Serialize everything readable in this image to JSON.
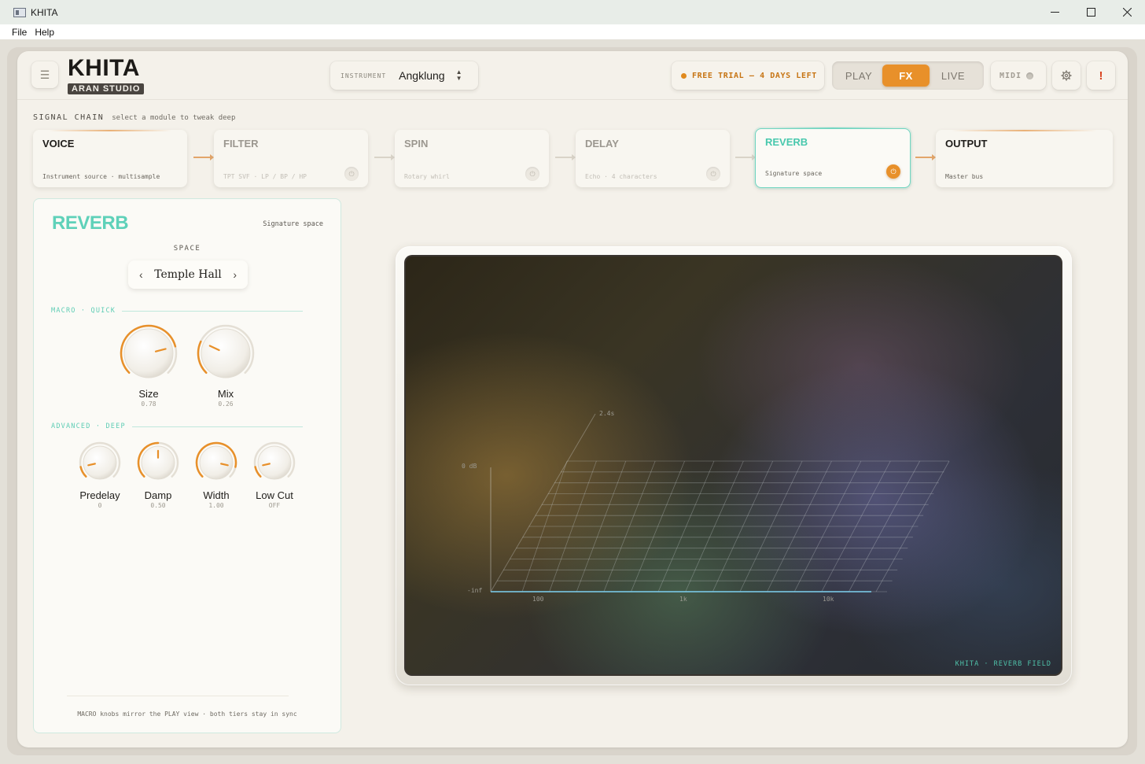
{
  "window": {
    "title": "KHITA",
    "minimize_icon": "minimize-icon",
    "maximize_icon": "maximize-icon",
    "close_icon": "close-icon"
  },
  "menubar": {
    "items": [
      "File",
      "Help"
    ]
  },
  "header": {
    "menu_icon": "hamburger-icon",
    "logo_title": "KHITA",
    "logo_badge": "ARAN STUDIO",
    "instrument": {
      "label": "INSTRUMENT",
      "value": "Angklung"
    },
    "trial": {
      "text": "FREE TRIAL — 4 DAYS LEFT",
      "dot_color": "#e08a1e"
    },
    "modes": [
      {
        "label": "PLAY",
        "active": false
      },
      {
        "label": "FX",
        "active": true
      },
      {
        "label": "LIVE",
        "active": false
      }
    ],
    "midi": {
      "label": "MIDI",
      "active": false
    },
    "settings_icon": "gear-icon",
    "alert_text": "!"
  },
  "signal_chain": {
    "label": "SIGNAL CHAIN",
    "hint": "select a module to tweak deep",
    "modules": [
      {
        "title": "VOICE",
        "subtitle": "Instrument source · multisample",
        "enabled": true,
        "has_power": false
      },
      {
        "title": "FILTER",
        "subtitle": "TPT SVF · LP / BP / HP",
        "enabled": false,
        "has_power": true
      },
      {
        "title": "SPIN",
        "subtitle": "Rotary whirl",
        "enabled": false,
        "has_power": true
      },
      {
        "title": "DELAY",
        "subtitle": "Echo · 4 characters",
        "enabled": false,
        "has_power": true
      },
      {
        "title": "REVERB",
        "subtitle": "Signature space",
        "enabled": true,
        "has_power": true,
        "selected": true
      },
      {
        "title": "OUTPUT",
        "subtitle": "Master bus",
        "enabled": true,
        "has_power": false
      }
    ]
  },
  "reverb_panel": {
    "title": "REVERB",
    "subtitle": "Signature space",
    "space": {
      "label": "SPACE",
      "value": "Temple Hall",
      "prev_icon": "chevron-left-icon",
      "next_icon": "chevron-right-icon"
    },
    "macro": {
      "label": "MACRO · QUICK",
      "knobs": [
        {
          "name": "Size",
          "value": "0.78",
          "level": 0.78
        },
        {
          "name": "Mix",
          "value": "0.26",
          "level": 0.26
        }
      ]
    },
    "advanced": {
      "label": "ADVANCED · DEEP",
      "knobs": [
        {
          "name": "Predelay",
          "value": "0",
          "level": 0.12
        },
        {
          "name": "Damp",
          "value": "0.50",
          "level": 0.5
        },
        {
          "name": "Width",
          "value": "1.00",
          "level": 0.88
        },
        {
          "name": "Low Cut",
          "value": "OFF",
          "level": 0.12
        }
      ]
    },
    "footer": "MACRO knobs mirror the PLAY view · both tiers stay in sync"
  },
  "visualizer": {
    "tag": "KHITA · REVERB FIELD",
    "axis_time_label": "2.4s",
    "axis_db_top": "0 dB",
    "axis_db_bottom": "-inf",
    "freq_labels": [
      "100",
      "1k",
      "10k"
    ]
  },
  "colors": {
    "accent": "#e8902a",
    "teal": "#5fd1b9",
    "panel_bg": "#f4f1ea"
  }
}
